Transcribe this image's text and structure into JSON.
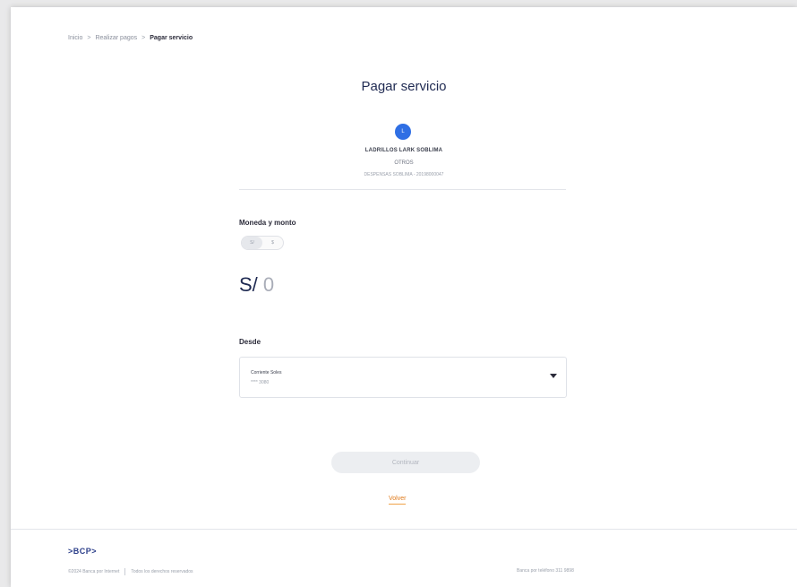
{
  "breadcrumb": {
    "items": [
      "Inicio",
      "Realizar pagos"
    ],
    "separator": ">",
    "current": "Pagar servicio"
  },
  "page": {
    "title": "Pagar servicio"
  },
  "service": {
    "avatar_initial": "L",
    "company": "LADRILLOS LARK SOBLIMA",
    "category": "OTROS",
    "detail": "DESPENSAS SOBLIMA - 20198000047"
  },
  "amount_section": {
    "label": "Moneda y monto",
    "currency_options": [
      "S/",
      "$"
    ],
    "selected_currency": "S/",
    "currency_symbol": "S/",
    "amount_value": "0"
  },
  "from_section": {
    "label": "Desde",
    "account_name": "Corriente Soles",
    "account_number": "**** 3080"
  },
  "actions": {
    "continue_label": "Continuar",
    "back_label": "Volver"
  },
  "footer": {
    "logo": ">BCP>",
    "copyright": "©2024 Banca por Internet",
    "rights": "Todos los derechos reservados",
    "phone": "Banca por teléfono 311 9898"
  },
  "colors": {
    "primary_blue": "#2f6fe4",
    "title_navy": "#1f2a52",
    "accent_orange": "#e07a1a",
    "disabled_button": "#eceef1"
  }
}
